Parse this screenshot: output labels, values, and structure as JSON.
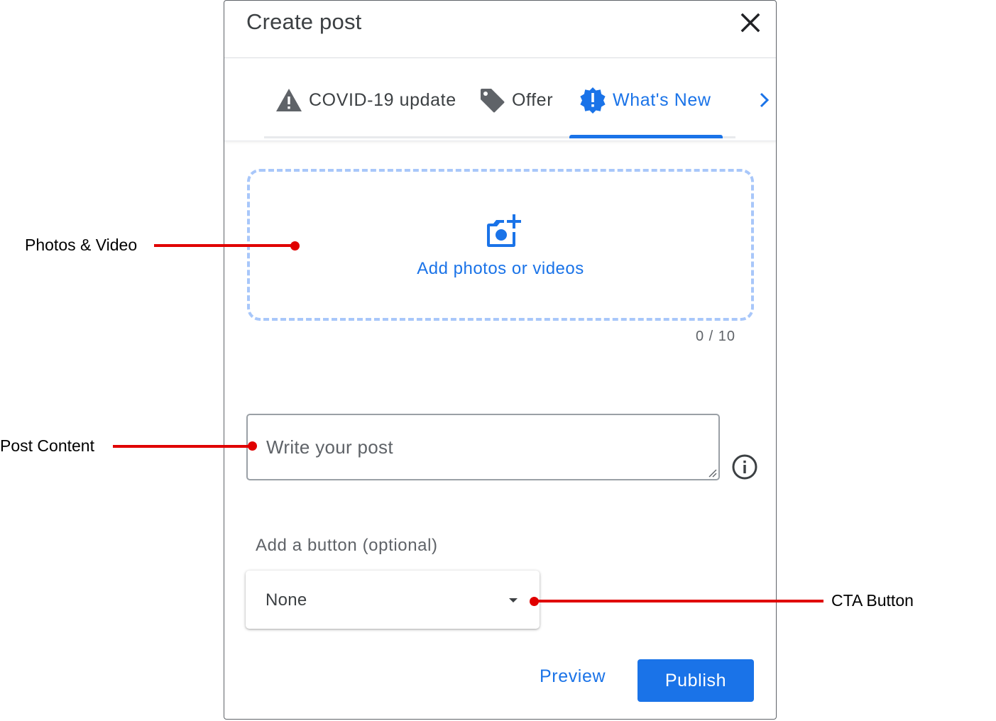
{
  "dialog": {
    "title": "Create post",
    "close_icon": "close-icon"
  },
  "tabs": {
    "items": [
      {
        "label": "COVID-19 update",
        "icon": "warning-icon"
      },
      {
        "label": "Offer",
        "icon": "tag-icon"
      },
      {
        "label": "What's New",
        "icon": "new-badge-icon",
        "active": true
      }
    ],
    "next_icon": "chevron-right-icon"
  },
  "upload": {
    "label": "Add photos or videos",
    "icon": "add-photo-icon",
    "count": "0 / 10"
  },
  "post": {
    "placeholder": "Write your post",
    "info_icon": "info-icon"
  },
  "cta": {
    "label": "Add a button (optional)",
    "selected": "None"
  },
  "actions": {
    "preview_label": "Preview",
    "publish_label": "Publish"
  },
  "annotations": {
    "photos": "Photos & Video",
    "post": "Post Content",
    "cta": "CTA Button"
  },
  "colors": {
    "accent": "#1a73e8",
    "annotation": "#e00000",
    "upload_border": "#a8c7fa"
  }
}
